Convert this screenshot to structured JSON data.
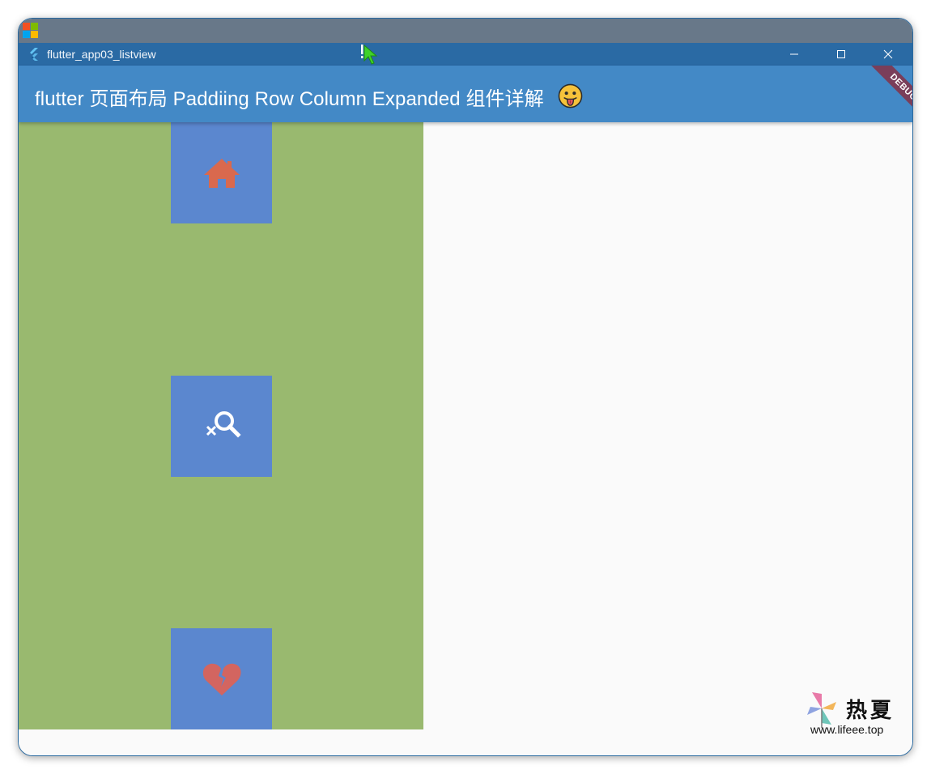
{
  "window": {
    "title": "flutter_app03_listview"
  },
  "appbar": {
    "title": "flutter 页面布局 Paddiing Row Column Expanded 组件详解",
    "emoji_icon": "tongue-out-face-icon"
  },
  "debug_banner": {
    "label": "DEBUG"
  },
  "column": {
    "background": "#99b96f",
    "tiles": [
      {
        "icon": "home-icon",
        "icon_color": "#d9694e"
      },
      {
        "icon": "search-off-icon",
        "icon_color": "#ffffff"
      },
      {
        "icon": "heart-broken-icon",
        "icon_color": "#d36560"
      }
    ],
    "tile_color": "#5b87cf"
  },
  "watermark": {
    "name": "热夏",
    "url": "www.lifeee.top"
  },
  "colors": {
    "appbar": "#4389c6",
    "titlebar": "#2a6aa4",
    "debug": "#7a3e5a"
  }
}
